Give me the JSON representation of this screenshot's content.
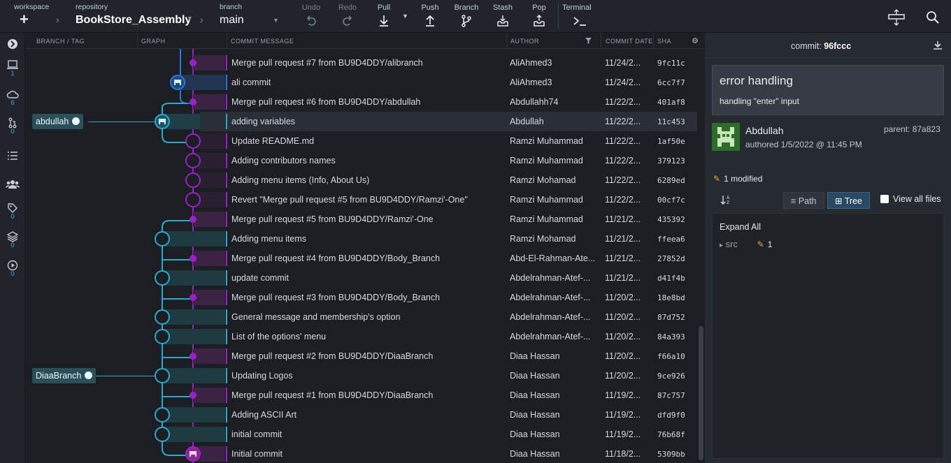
{
  "toolbar": {
    "workspace_label": "workspace",
    "repository_label": "repository",
    "repository_name": "BookStore_Assembly",
    "branch_label": "branch",
    "branch_name": "main",
    "undo": "Undo",
    "redo": "Redo",
    "pull": "Pull",
    "push": "Push",
    "branch": "Branch",
    "stash": "Stash",
    "pop": "Pop",
    "terminal": "Terminal"
  },
  "rail": {
    "items": [
      {
        "icon": "expand-icon",
        "count": ""
      },
      {
        "icon": "laptop-icon",
        "count": "1"
      },
      {
        "icon": "cloud-icon",
        "count": "6"
      },
      {
        "icon": "pull-request-icon",
        "count": "0"
      },
      {
        "icon": "list-icon",
        "count": ""
      },
      {
        "icon": "team-icon",
        "count": ""
      },
      {
        "icon": "tag-icon",
        "count": "0"
      },
      {
        "icon": "stack-icon",
        "count": "0"
      },
      {
        "icon": "play-icon",
        "count": "0"
      }
    ]
  },
  "columns": {
    "branch_tag": "BRANCH / TAG",
    "graph": "GRAPH",
    "commit_message": "COMMIT MESSAGE",
    "author": "AUTHOR",
    "commit_date": "COMMIT DATE",
    "sha": "SHA"
  },
  "branch_labels": {
    "abdullah": "abdullah",
    "diaa": "DiaaBranch"
  },
  "commits": [
    {
      "message": "Merge pull request #7 from BU9D4DDY/alibranch",
      "author": "AliAhmed3",
      "date": "11/24/2...",
      "sha": "9fc11c"
    },
    {
      "message": "ali commit",
      "author": "AliAhmed3",
      "date": "11/24/2...",
      "sha": "6cc7f7"
    },
    {
      "message": "Merge pull request #6 from BU9D4DDY/abdullah",
      "author": "Abdullahh74",
      "date": "11/22/2...",
      "sha": "401af8"
    },
    {
      "message": "adding variables",
      "author": "Abdullah",
      "date": "11/22/2...",
      "sha": "11c453"
    },
    {
      "message": "Update README.md",
      "author": "Ramzi Muhammad",
      "date": "11/22/2...",
      "sha": "1af50e"
    },
    {
      "message": "Adding contributors names",
      "author": "Ramzi Muhammad",
      "date": "11/22/2...",
      "sha": "379123"
    },
    {
      "message": "Adding menu items (Info, About Us)",
      "author": "Ramzi Mohamad",
      "date": "11/22/2...",
      "sha": "6289ed"
    },
    {
      "message": "Revert \"Merge pull request #5 from BU9D4DDY/Ramzi'-One\"",
      "author": "Ramzi Muhammad",
      "date": "11/22/2...",
      "sha": "00cf7c"
    },
    {
      "message": "Merge pull request #5 from BU9D4DDY/Ramzi'-One",
      "author": "Ramzi Muhammad",
      "date": "11/21/2...",
      "sha": "435392"
    },
    {
      "message": "Adding menu items",
      "author": "Ramzi Mohamad",
      "date": "11/21/2...",
      "sha": "ffeea6"
    },
    {
      "message": "Merge pull request #4 from BU9D4DDY/Body_Branch",
      "author": "Abd-El-Rahman-Ate...",
      "date": "11/21/2...",
      "sha": "27852d"
    },
    {
      "message": "update commit",
      "author": "Abdelrahman-Atef-...",
      "date": "11/21/2...",
      "sha": "d41f4b"
    },
    {
      "message": "Merge pull request #3 from BU9D4DDY/Body_Branch",
      "author": "Abdelrahman-Atef-...",
      "date": "11/20/2...",
      "sha": "18e8bd"
    },
    {
      "message": "General message and membership's option",
      "author": "Abdelrahman-Atef-...",
      "date": "11/20/2...",
      "sha": "87d752"
    },
    {
      "message": "List of the options' menu",
      "author": "Abdelrahman-Atef-...",
      "date": "11/20/2...",
      "sha": "84a393"
    },
    {
      "message": "Merge pull request #2 from BU9D4DDY/DiaaBranch",
      "author": "Diaa Hassan",
      "date": "11/20/2...",
      "sha": "f66a10"
    },
    {
      "message": "Updating Logos",
      "author": "Diaa Hassan",
      "date": "11/20/2...",
      "sha": "9ce926"
    },
    {
      "message": "Merge pull request #1 from BU9D4DDY/DiaaBranch",
      "author": "Diaa Hassan",
      "date": "11/19/2...",
      "sha": "87c757"
    },
    {
      "message": "Adding ASCII Art",
      "author": "Diaa Hassan",
      "date": "11/19/2...",
      "sha": "dfd9f0"
    },
    {
      "message": "initial commit",
      "author": "Diaa Hassan",
      "date": "11/19/2...",
      "sha": "76b68f"
    },
    {
      "message": "Initial commit",
      "author": "Diaa Hassan",
      "date": "11/18/2...",
      "sha": "5309bb"
    }
  ],
  "detail": {
    "commit_label": "commit:",
    "commit_sha": "96fccc",
    "summary": "error handling",
    "description": "handling \"enter\" input",
    "author": "Abdullah",
    "authored": "authored  1/5/2022 @ 11:45 PM",
    "parent": "parent:  87a823",
    "modified": "1 modified",
    "path_tab": "Path",
    "tree_tab": "Tree",
    "view_all": "View all files",
    "expand_all": "Expand All",
    "folder": "src",
    "folder_count": "1"
  },
  "colors": {
    "main_lane": "#9b20c9",
    "branch_lane": "#2fa9c9",
    "ali_lane": "#2b78d8"
  }
}
